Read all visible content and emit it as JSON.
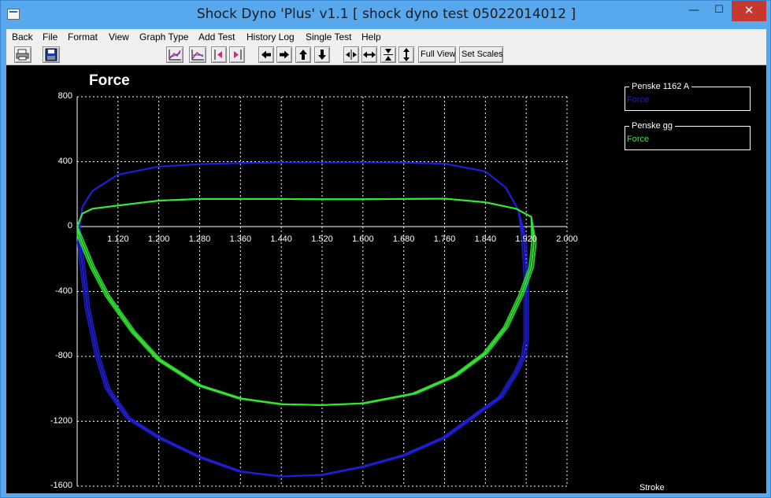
{
  "window": {
    "title": "Shock Dyno 'Plus' v1.1  [ shock dyno test 05022014012 ]"
  },
  "menu": [
    "Back",
    "File",
    "Format",
    "View",
    "Graph Type",
    "Add Test",
    "History Log",
    "Single Test",
    "Help"
  ],
  "toolbar": {
    "full_view": "Full View",
    "set_scales": "Set Scales",
    "icons": [
      "printer-icon",
      "save-disk-icon",
      "graph-type-icon",
      "graph-overlay-icon",
      "bracket-left-icon",
      "bracket-right-icon",
      "arrow-left-icon",
      "arrow-right-icon",
      "arrow-up-icon",
      "arrow-down-icon",
      "shrink-horizontal-icon",
      "expand-horizontal-icon",
      "shrink-vertical-icon",
      "expand-vertical-icon"
    ]
  },
  "chart": {
    "title": "Force",
    "stroke_label": "Stroke",
    "legend": [
      {
        "name": "Penske 1162 A",
        "series": "Force",
        "color": "#1f1fd6"
      },
      {
        "name": "Penske gg",
        "series": "Force",
        "color": "#33e833"
      }
    ]
  },
  "chart_data": {
    "type": "line",
    "title": "Force",
    "xlabel": "Stroke",
    "ylabel": "",
    "xlim": [
      1.04,
      2.0
    ],
    "ylim": [
      -1600,
      800
    ],
    "x_ticks": [
      "1.120",
      "1.200",
      "1.280",
      "1.360",
      "1.440",
      "1.520",
      "1.600",
      "1.680",
      "1.760",
      "1.840",
      "1.920",
      "2.000"
    ],
    "y_ticks": [
      "800",
      "400",
      "0",
      "-400",
      "-800",
      "-1200",
      "-1600"
    ],
    "grid": true,
    "legend_position": "top-right",
    "series": [
      {
        "name": "Penske 1162 A",
        "label": "Force",
        "color": "#1f1fd6",
        "x": [
          1.045,
          1.05,
          1.07,
          1.12,
          1.2,
          1.28,
          1.36,
          1.44,
          1.52,
          1.6,
          1.68,
          1.76,
          1.84,
          1.88,
          1.905,
          1.915,
          1.92,
          1.92,
          1.915,
          1.9,
          1.87,
          1.83,
          1.76,
          1.68,
          1.6,
          1.52,
          1.44,
          1.36,
          1.28,
          1.2,
          1.14,
          1.1,
          1.08,
          1.06,
          1.045
        ],
        "y": [
          0,
          120,
          220,
          320,
          370,
          385,
          392,
          395,
          395,
          395,
          394,
          388,
          340,
          240,
          100,
          -60,
          -300,
          -700,
          -800,
          -900,
          -1050,
          -1140,
          -1300,
          -1410,
          -1480,
          -1530,
          -1540,
          -1510,
          -1420,
          -1300,
          -1180,
          -1000,
          -800,
          -500,
          -100
        ]
      },
      {
        "name": "Penske gg",
        "label": "Force",
        "color": "#33e833",
        "x": [
          1.04,
          1.05,
          1.07,
          1.12,
          1.2,
          1.28,
          1.36,
          1.44,
          1.52,
          1.6,
          1.68,
          1.76,
          1.84,
          1.9,
          1.93,
          1.935,
          1.93,
          1.91,
          1.88,
          1.84,
          1.78,
          1.7,
          1.6,
          1.52,
          1.44,
          1.36,
          1.28,
          1.2,
          1.15,
          1.1,
          1.07,
          1.045
        ],
        "y": [
          0,
          80,
          110,
          130,
          160,
          170,
          170,
          170,
          168,
          168,
          170,
          172,
          150,
          110,
          60,
          -100,
          -250,
          -420,
          -620,
          -780,
          -920,
          -1030,
          -1090,
          -1100,
          -1095,
          -1060,
          -980,
          -820,
          -650,
          -430,
          -250,
          -60
        ]
      }
    ]
  }
}
